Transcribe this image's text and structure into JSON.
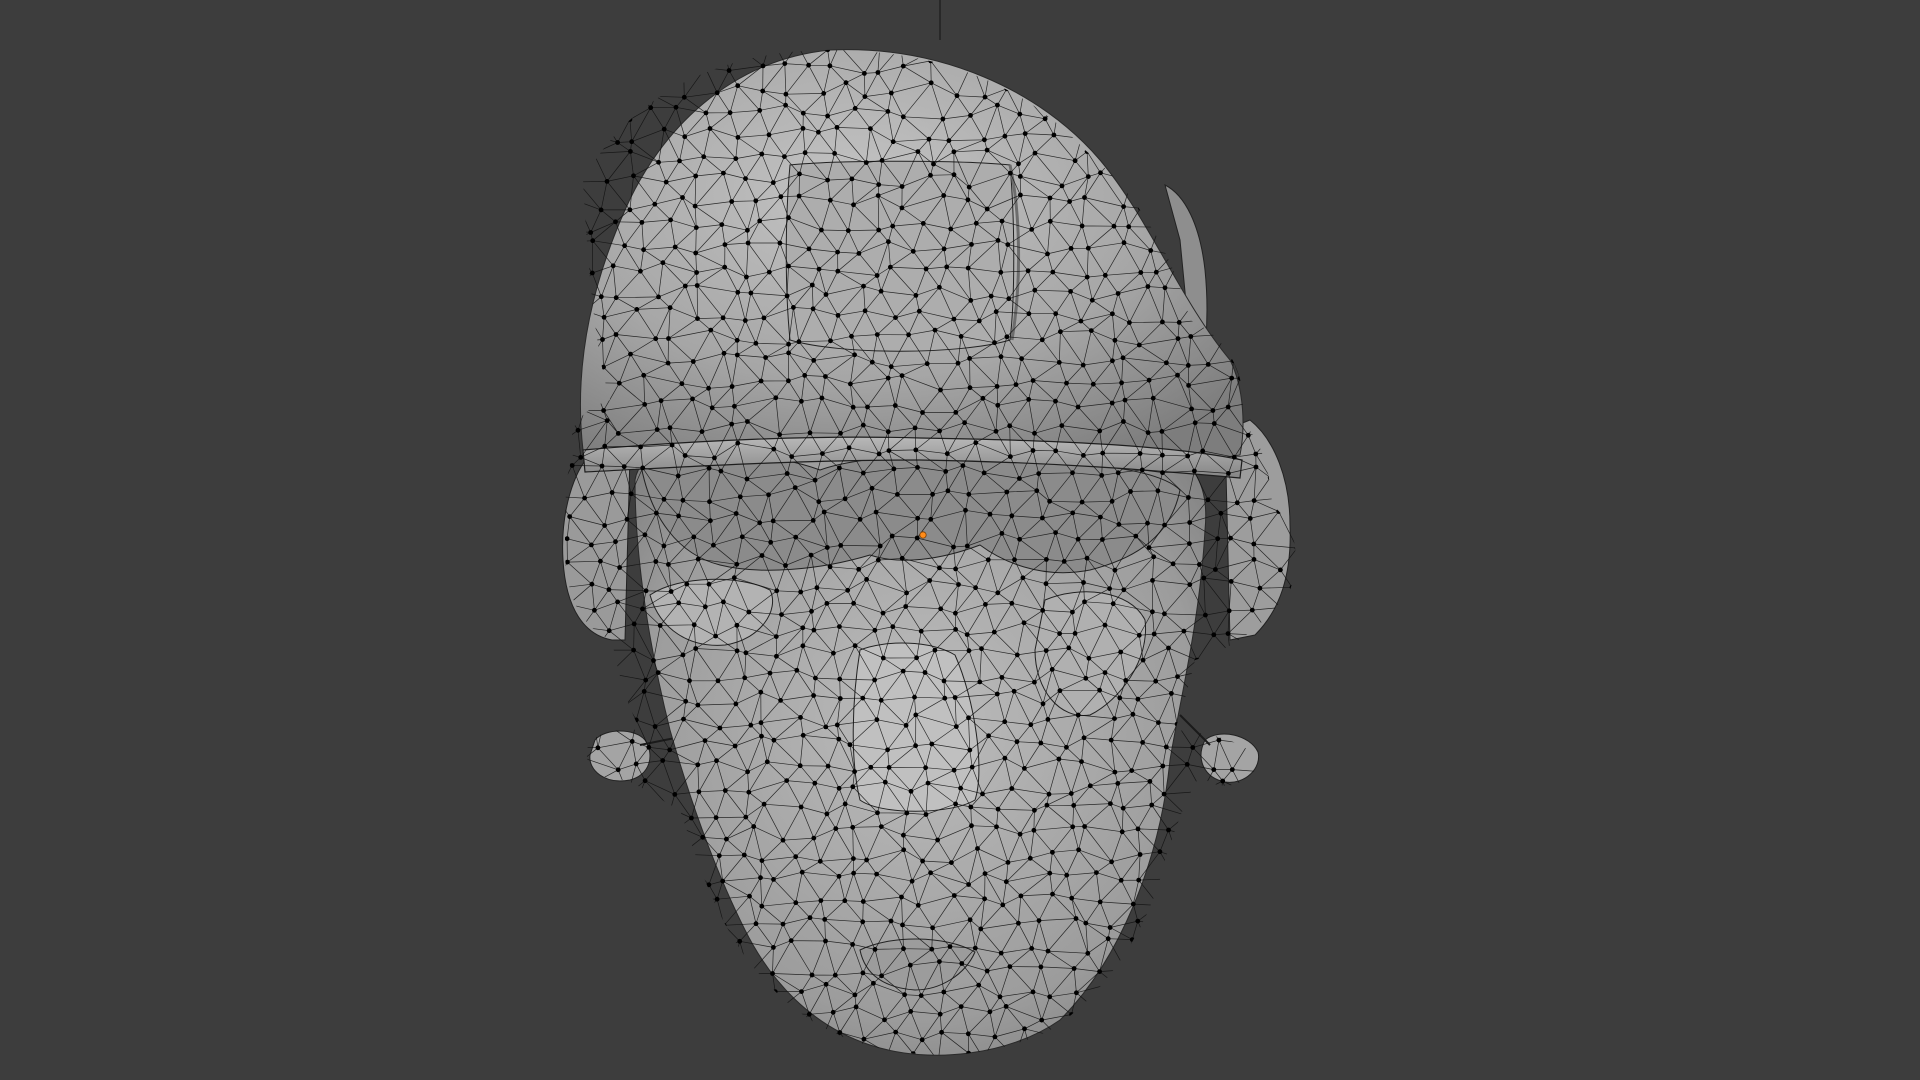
{
  "viewport": {
    "background_color": "#3d3d3d",
    "mode": "edit-mode-wireframe-overlay",
    "object": {
      "kind": "sculpted-head-with-helmet-and-headset",
      "surface_color": "#a9a9a9",
      "edge_color": "#111111",
      "vertex_color": "#000000",
      "origin_marker_color": "#ff8c1a"
    }
  }
}
